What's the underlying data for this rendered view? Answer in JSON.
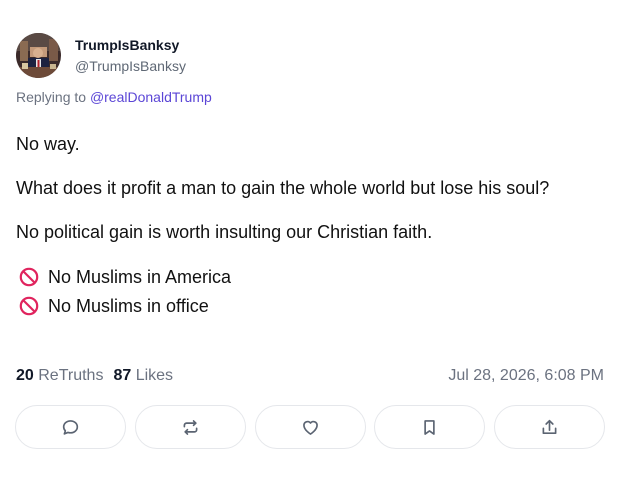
{
  "author": {
    "display_name": "TrumpIsBanksy",
    "handle": "@TrumpIsBanksy",
    "avatar_icon": "avatar-photo"
  },
  "reply": {
    "prefix": "Replying to ",
    "mention": "@realDonaldTrump"
  },
  "content": {
    "paragraphs": [
      "No way.",
      "What does it profit a man to gain the whole world but lose his soul?",
      "No political gain is worth insulting our Christian faith."
    ],
    "list_items": [
      {
        "icon": "prohibited-icon",
        "text": "No Muslims in America"
      },
      {
        "icon": "prohibited-icon",
        "text": "No Muslims in office"
      }
    ]
  },
  "stats": {
    "retruths_count": "20",
    "retruths_label": "ReTruths",
    "likes_count": "87",
    "likes_label": "Likes",
    "timestamp": "Jul 28, 2026, 6:08 PM"
  },
  "actions": [
    {
      "name": "reply",
      "icon": "comment-icon"
    },
    {
      "name": "retruth",
      "icon": "repost-icon"
    },
    {
      "name": "like",
      "icon": "heart-icon"
    },
    {
      "name": "bookmark",
      "icon": "bookmark-icon"
    },
    {
      "name": "share",
      "icon": "share-icon"
    }
  ],
  "colors": {
    "text": "#111111",
    "muted": "#6b7280",
    "mention": "#5b46d6",
    "prohibited": "#e0245e",
    "border": "#e5e7eb"
  }
}
